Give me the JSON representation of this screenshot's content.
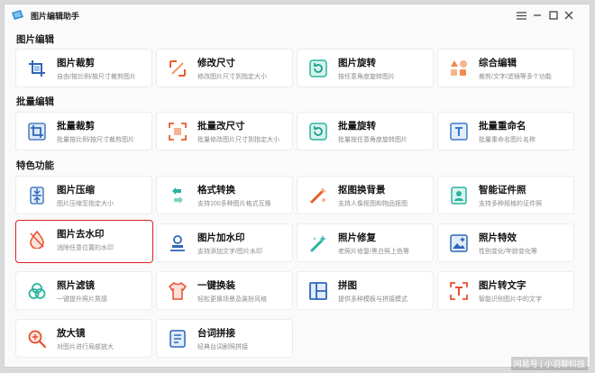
{
  "app": {
    "title": "图片编辑助手"
  },
  "sections": [
    {
      "title": "图片编辑"
    },
    {
      "title": "批量编辑"
    },
    {
      "title": "特色功能"
    }
  ],
  "cards": [
    {
      "title": "图片裁剪",
      "desc": "自由/按比例/按尺寸裁剪图片",
      "icon": "crop-icon"
    },
    {
      "title": "修改尺寸",
      "desc": "修改图片尺寸到指定大小",
      "icon": "resize-icon"
    },
    {
      "title": "图片旋转",
      "desc": "按任意角度旋转图片",
      "icon": "rotate-icon"
    },
    {
      "title": "综合编辑",
      "desc": "裁剪/文字/滤镜等多个功能",
      "icon": "shapes-icon"
    },
    {
      "title": "批量裁剪",
      "desc": "批量按比例/按尺寸裁剪图片",
      "icon": "batch-crop-icon"
    },
    {
      "title": "批量改尺寸",
      "desc": "批量修改图片尺寸到指定大小",
      "icon": "batch-resize-icon"
    },
    {
      "title": "批量旋转",
      "desc": "批量按任意角度旋转图片",
      "icon": "batch-rotate-icon"
    },
    {
      "title": "批量重命名",
      "desc": "批量重命名图片名称",
      "icon": "rename-icon"
    },
    {
      "title": "图片压缩",
      "desc": "图片压缩至指定大小",
      "icon": "compress-icon"
    },
    {
      "title": "格式转换",
      "desc": "支持100多种图片格式互换",
      "icon": "convert-icon"
    },
    {
      "title": "抠图换背景",
      "desc": "支持人像抠图和物品抠图",
      "icon": "cutout-icon"
    },
    {
      "title": "智能证件照",
      "desc": "支持多种规格的证件照",
      "icon": "id-photo-icon"
    },
    {
      "title": "图片去水印",
      "desc": "消除任意位置的水印",
      "icon": "remove-watermark-icon"
    },
    {
      "title": "图片加水印",
      "desc": "支持添加文字/图片水印",
      "icon": "add-watermark-icon"
    },
    {
      "title": "照片修复",
      "desc": "老照片修复/黑白照上色等",
      "icon": "repair-icon"
    },
    {
      "title": "照片特效",
      "desc": "性别变化/年龄变化等",
      "icon": "effects-icon"
    },
    {
      "title": "照片滤镜",
      "desc": "一键提升照片质感",
      "icon": "filter-icon"
    },
    {
      "title": "一键换装",
      "desc": "轻松更换场景及装扮风格",
      "icon": "outfit-icon"
    },
    {
      "title": "拼图",
      "desc": "提供多种模板与拼接模式",
      "icon": "collage-icon"
    },
    {
      "title": "图片转文字",
      "desc": "智能识别图片中的文字",
      "icon": "ocr-icon"
    },
    {
      "title": "放大镜",
      "desc": "对图片进行局部放大",
      "icon": "magnifier-icon"
    },
    {
      "title": "台词拼接",
      "desc": "经典台词剧照拼接",
      "icon": "subtitle-stitch-icon"
    }
  ],
  "highlighted_card": "图片去水印",
  "watermark": "网易号 | 小羽聊科技",
  "colors": {
    "accent": "#3aa0d8",
    "highlight": "#e02020",
    "window_bg": "#fafafa"
  }
}
